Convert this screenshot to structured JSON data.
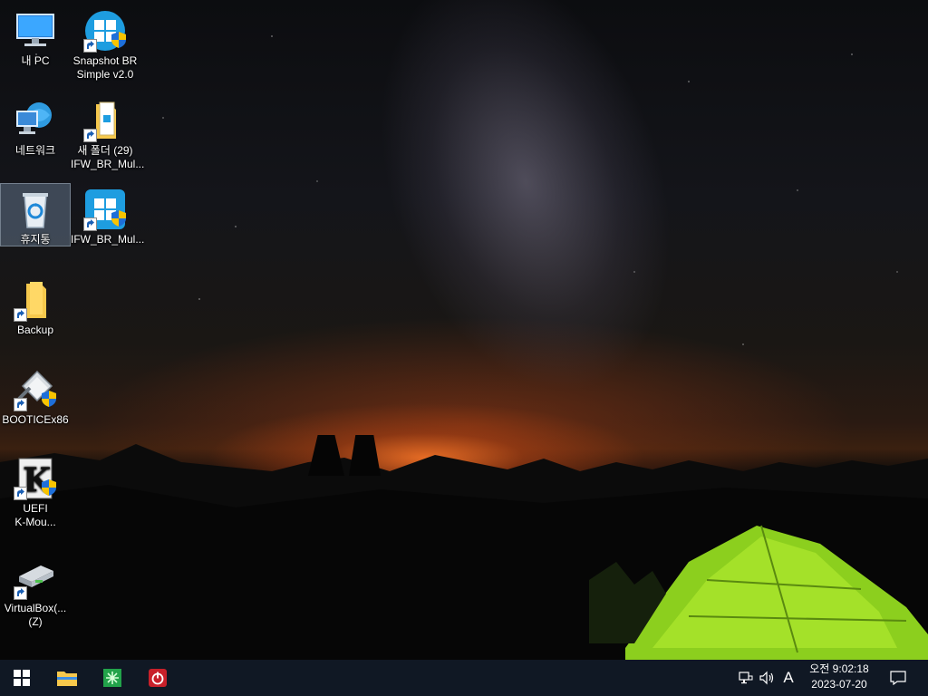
{
  "desktop": {
    "icons": [
      {
        "label": "내 PC",
        "icon": "computer-icon"
      },
      {
        "label": "Snapshot BR\nSimple v2.0",
        "icon": "snapshot-br-icon"
      },
      {
        "label": "네트워크",
        "icon": "network-icon"
      },
      {
        "label": "새 폴더 (29)\nIFW_BR_Mul...",
        "icon": "folder-doc-icon"
      },
      {
        "label": "휴지통",
        "icon": "recycle-bin-icon"
      },
      {
        "label": "IFW_BR_Mul...",
        "icon": "snapshot-br-icon"
      },
      {
        "label": "Backup",
        "icon": "folder-icon"
      },
      {
        "label": "BOOTICEx86",
        "icon": "bootice-icon"
      },
      {
        "label": "UEFI\nK-Mou...",
        "icon": "kmou-icon"
      },
      {
        "label": "VirtualBox(...\n(Z)",
        "icon": "network-drive-icon"
      }
    ]
  },
  "taskbar": {
    "start_icon": "windows-logo-icon",
    "pinned": [
      "file-explorer-icon",
      "green-app-icon",
      "power-app-icon"
    ],
    "tray": {
      "network_icon": "network-tray-icon",
      "volume_icon": "volume-icon",
      "ime_label": "A",
      "time": "오전 9:02:18",
      "date": "2023-07-20",
      "notification_icon": "action-center-icon"
    }
  },
  "colors": {
    "taskbar_bg": "#101824",
    "accent_blue": "#1e9de0",
    "folder_yellow": "#f6c84c"
  }
}
